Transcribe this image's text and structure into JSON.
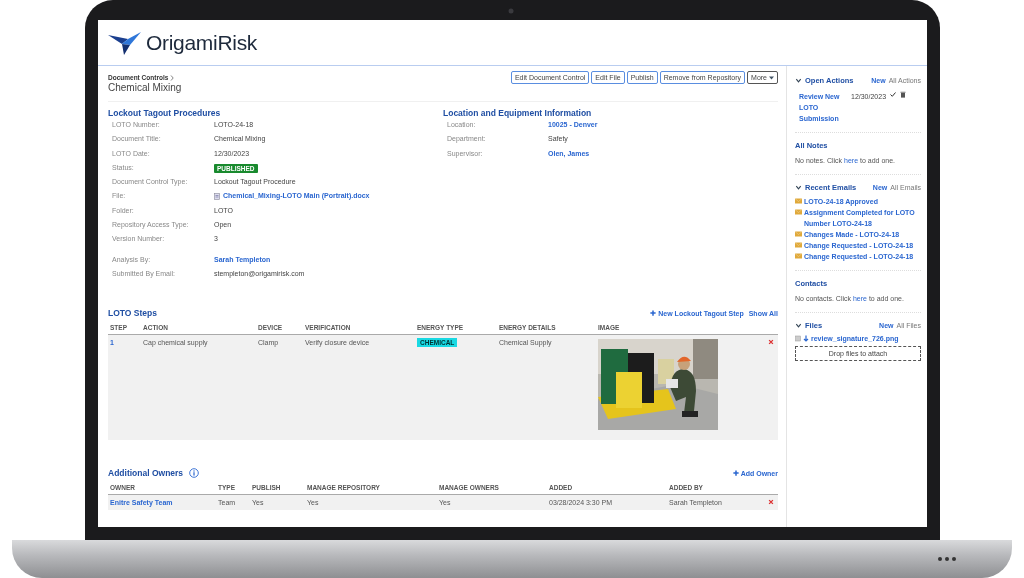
{
  "logo": {
    "text": "OrigamiRisk"
  },
  "breadcrumb": "Document Controls",
  "title": "Chemical Mixing",
  "action_buttons": [
    {
      "label": "Edit Document Control",
      "kind": "button"
    },
    {
      "label": "Edit File",
      "kind": "button"
    },
    {
      "label": "Publish",
      "kind": "button"
    },
    {
      "label": "Remove from Repository",
      "kind": "button"
    },
    {
      "label": "More",
      "kind": "dropdown"
    }
  ],
  "procedure": {
    "title": "Lockout Tagout Procedures",
    "fields": [
      {
        "label": "LOTO Number:",
        "value": "LOTO-24-18",
        "kind": "text"
      },
      {
        "label": "Document Title:",
        "value": "Chemical Mixing",
        "kind": "text"
      },
      {
        "label": "LOTO Date:",
        "value": "12/30/2023",
        "kind": "text"
      },
      {
        "label": "Status:",
        "value": "PUBLISHED",
        "kind": "badge"
      },
      {
        "label": "Document Control Type:",
        "value": "Lockout Tagout Procedure",
        "kind": "text"
      },
      {
        "label": "File:",
        "value": "Chemical_Mixing-LOTO Main (Portrait).docx",
        "kind": "file"
      },
      {
        "label": "Folder:",
        "value": "LOTO",
        "kind": "text"
      },
      {
        "label": "Repository Access Type:",
        "value": "Open",
        "kind": "text"
      },
      {
        "label": "Version Number:",
        "value": "3",
        "kind": "text"
      }
    ],
    "extra_fields": [
      {
        "label": "Analysis By:",
        "value": "Sarah Templeton",
        "kind": "link"
      },
      {
        "label": "Submitted By Email:",
        "value": "stempleton@origamirisk.com",
        "kind": "text"
      }
    ]
  },
  "location": {
    "title": "Location and Equipment Information",
    "fields": [
      {
        "label": "Location:",
        "value": "10025 - Denver",
        "kind": "link"
      },
      {
        "label": "Department:",
        "value": "Safety",
        "kind": "text"
      },
      {
        "label": "Supervisor:",
        "value": "Olen, James",
        "kind": "link"
      }
    ]
  },
  "steps": {
    "title": "LOTO Steps",
    "new_label": "New Lockout Tagout Step",
    "show_all": "Show All",
    "columns": [
      "STEP",
      "ACTION",
      "DEVICE",
      "VERIFICATION",
      "ENERGY TYPE",
      "ENERGY DETAILS",
      "IMAGE"
    ],
    "rows": [
      {
        "step": "1",
        "action": "Cap chemical supply",
        "device": "Clamp",
        "verification": "Verify closure device",
        "energy_type": "CHEMICAL",
        "energy_details": "Chemical Supply"
      }
    ]
  },
  "owners": {
    "title": "Additional Owners",
    "add_label": "Add Owner",
    "columns": [
      "OWNER",
      "TYPE",
      "PUBLISH",
      "MANAGE REPOSITORY",
      "MANAGE OWNERS",
      "ADDED",
      "ADDED BY"
    ],
    "rows": [
      {
        "owner": "Enitre Safety Team",
        "type": "Team",
        "publish": "Yes",
        "manage_repository": "Yes",
        "manage_owners": "Yes",
        "added": "03/28/2024 3:30 PM",
        "added_by": "Sarah Templeton"
      }
    ]
  },
  "sidebar": {
    "open_actions": {
      "title": "Open Actions",
      "new": "New",
      "all": "All Actions",
      "items": [
        {
          "title": "Review New LOTO Submission",
          "date": "12/30/2023"
        }
      ]
    },
    "notes": {
      "title": "All Notes",
      "before": "No notes. Click ",
      "link": "here",
      "after": " to add one."
    },
    "emails": {
      "title": "Recent Emails",
      "new": "New",
      "all": "All Emails",
      "items": [
        "LOTO-24-18 Approved",
        "Assignment Completed for LOTO Number LOTO-24-18",
        "Changes Made - LOTO-24-18",
        "Change Requested - LOTO-24-18",
        "Change Requested - LOTO-24-18"
      ]
    },
    "contacts": {
      "title": "Contacts",
      "before": "No contacts. Click ",
      "link": "here",
      "after": " to add one."
    },
    "files": {
      "title": "Files",
      "new": "New",
      "all": "All Files",
      "items": [
        "review_signature_726.png"
      ],
      "drop": "Drop files to attach"
    }
  }
}
